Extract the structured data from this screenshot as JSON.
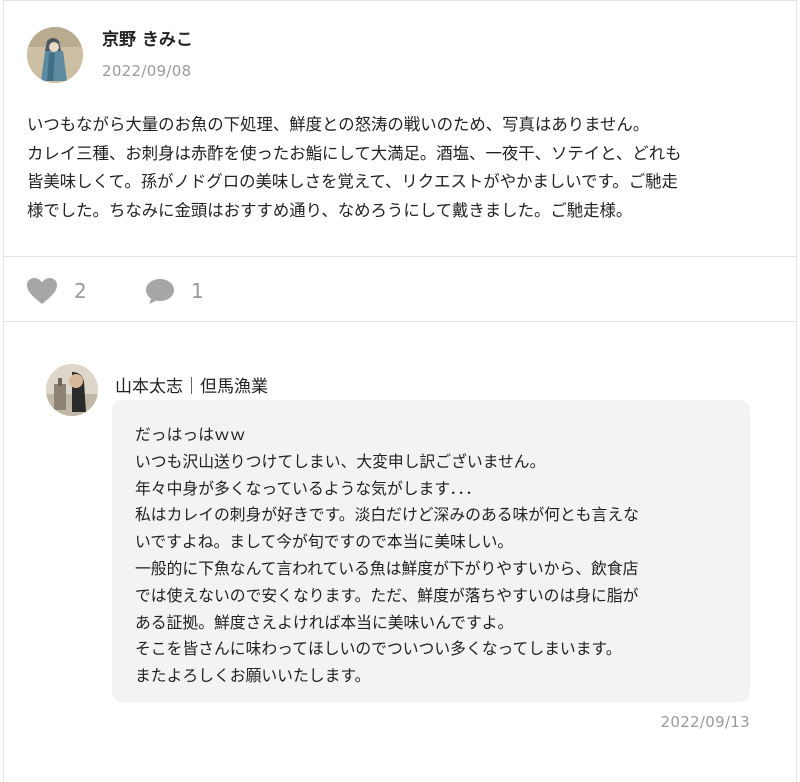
{
  "post": {
    "author": "京野 きみこ",
    "date": "2022/09/08",
    "body_lines": [
      "いつもながら大量のお魚の下処理、鮮度との怒涛の戦いのため、写真はありません。",
      "カレイ三種、お刺身は赤酢を使ったお鮨にして大満足。酒塩、一夜干、ソテイと、どれも",
      "皆美味しくて。孫がノドグロの美味しさを覚えて、リクエストがやかましいです。ご馳走",
      "様でした。ちなみに金頭はおすすめ通り、なめろうにして戴きました。ご馳走様。"
    ]
  },
  "actions": {
    "like_icon": "heart-icon",
    "like_count": "2",
    "comment_icon": "comment-bubble-icon",
    "comment_count": "1",
    "icon_color": "#a6a6a6"
  },
  "reply": {
    "author": "山本太志｜但馬漁業",
    "lines": [
      "だっはっはｗｗ",
      "いつも沢山送りつけてしまい、大変申し訳ございません。",
      "年々中身が多くなっているような気がします．．．",
      "私はカレイの刺身が好きです。淡白だけど深みのある味が何とも言えな",
      "いですよね。まして今が旬ですので本当に美味しい。",
      "一般的に下魚なんて言われている魚は鮮度が下がりやすいから、飲食店",
      "では使えないので安くなります。ただ、鮮度が落ちやすいのは身に脂が",
      "ある証拠。鮮度さえよければ本当に美味いんですよ。",
      "そこを皆さんに味わってほしいのでついつい多くなってしまいます。",
      "またよろしくお願いいたします。"
    ],
    "date": "2022/09/13"
  }
}
